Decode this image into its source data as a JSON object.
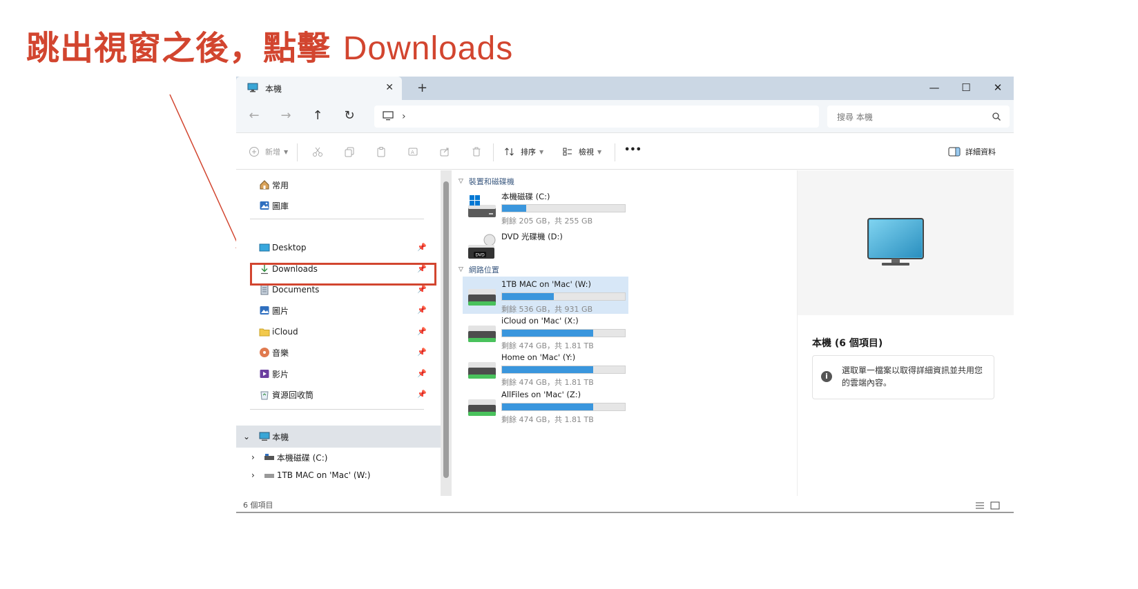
{
  "heading": {
    "cjk": "跳出視窗之後，點擊 ",
    "latin": "Downloads"
  },
  "window": {
    "tab_title": "本機",
    "tab_close": "✕",
    "new_tab": "+",
    "controls": {
      "minimize": "—",
      "maximize": "☐",
      "close": "✕"
    },
    "nav": {
      "back": "←",
      "forward": "→",
      "up": "↑",
      "refresh": "↻"
    },
    "address_chevron": "›",
    "search_placeholder": "搜尋 本機",
    "commands": {
      "new": "新增",
      "sort": "排序",
      "view": "檢視",
      "more": "•••",
      "details": "詳細資料"
    },
    "nav_pane": {
      "quick": [
        {
          "label": "常用",
          "icon": "home-icon"
        },
        {
          "label": "圖庫",
          "icon": "gallery-icon"
        }
      ],
      "pinned": [
        {
          "label": "Desktop",
          "icon": "desktop-folder-icon"
        },
        {
          "label": "Downloads",
          "icon": "download-icon"
        },
        {
          "label": "Documents",
          "icon": "documents-icon"
        },
        {
          "label": "圖片",
          "icon": "pictures-icon"
        },
        {
          "label": "iCloud",
          "icon": "folder-icon"
        },
        {
          "label": "音樂",
          "icon": "music-icon"
        },
        {
          "label": "影片",
          "icon": "videos-icon"
        },
        {
          "label": "資源回收筒",
          "icon": "recycle-bin-icon"
        }
      ],
      "tree": [
        {
          "label": "本機",
          "chevron": "⌄"
        },
        {
          "label": "本機磁碟 (C:)",
          "chevron": "›"
        },
        {
          "label": "1TB MAC on 'Mac' (W:)",
          "chevron": "›"
        }
      ]
    },
    "groups": {
      "devices": "裝置和磁碟機",
      "network": "網路位置"
    },
    "drives": [
      {
        "name": "本機磁碟 (C:)",
        "free": "剩餘 205 GB，共 255 GB",
        "used_fraction": 0.196,
        "icon": "windows-drive-icon"
      },
      {
        "name": "DVD 光碟機 (D:)",
        "free": "",
        "used_fraction": null,
        "icon": "dvd-drive-icon",
        "dvd_label": "DVD"
      },
      {
        "name": "1TB MAC on 'Mac' (W:)",
        "free": "剩餘 536 GB，共 931 GB",
        "used_fraction": 0.424,
        "icon": "network-drive-icon"
      },
      {
        "name": "iCloud on 'Mac' (X:)",
        "free": "剩餘 474 GB，共 1.81 TB",
        "used_fraction": 0.744,
        "icon": "network-drive-icon"
      },
      {
        "name": "Home on 'Mac' (Y:)",
        "free": "剩餘 474 GB，共 1.81 TB",
        "used_fraction": 0.744,
        "icon": "network-drive-icon"
      },
      {
        "name": "AllFiles on 'Mac' (Z:)",
        "free": "剩餘 474 GB，共 1.81 TB",
        "used_fraction": 0.744,
        "icon": "network-drive-icon"
      }
    ],
    "details_pane": {
      "title": "本機 (6 個項目)",
      "info_icon": "i",
      "info_text": "選取單一檔案以取得詳細資訊並共用您的雲端內容。"
    },
    "status_text": "6 個項目"
  },
  "colors": {
    "accent": "#d2452f",
    "bar_fill": "#3a96dd",
    "selection": "#d7e7f7"
  }
}
